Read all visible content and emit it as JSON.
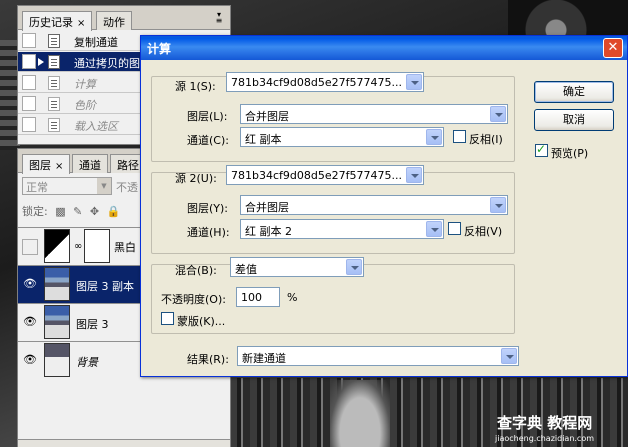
{
  "history": {
    "tabs": [
      "历史记录",
      "动作"
    ],
    "items": [
      {
        "label": "复制通道",
        "state": "normal"
      },
      {
        "label": "通过拷贝的图层",
        "state": "selected"
      },
      {
        "label": "计算",
        "state": "dim"
      },
      {
        "label": "色阶",
        "state": "dim"
      },
      {
        "label": "载入选区",
        "state": "dim"
      }
    ]
  },
  "layers": {
    "tabs": [
      "图层",
      "通道",
      "路径"
    ],
    "blend_mode": "正常",
    "opacity_label": "不透",
    "lock_label": "锁定:",
    "items": [
      {
        "name": "黑白",
        "visible": false
      },
      {
        "name": "图层 3 副本",
        "visible": true,
        "selected": true
      },
      {
        "name": "图层 3",
        "visible": true
      },
      {
        "name": "背景",
        "visible": true
      }
    ]
  },
  "dialog": {
    "title": "计算",
    "source1": {
      "label": "源 1(S):",
      "file": "781b34cf9d08d5e27f577475...",
      "layer_label": "图层(L):",
      "layer_value": "合并图层",
      "channel_label": "通道(C):",
      "channel_value": "红 副本",
      "invert_label": "反相(I)"
    },
    "source2": {
      "label": "源 2(U):",
      "file": "781b34cf9d08d5e27f577475...",
      "layer_label": "图层(Y):",
      "layer_value": "合并图层",
      "channel_label": "通道(H):",
      "channel_value": "红 副本 2",
      "invert_label": "反相(V)"
    },
    "blending": {
      "label": "混合(B):",
      "value": "差值",
      "opacity_label": "不透明度(O):",
      "opacity_value": "100",
      "opacity_unit": "%",
      "mask_label": "蒙版(K)..."
    },
    "result": {
      "label": "结果(R):",
      "value": "新建通道"
    },
    "buttons": {
      "ok": "确定",
      "cancel": "取消",
      "preview": "预览(P)"
    }
  },
  "watermark": {
    "text": "查字典 教程网",
    "url": "jiaocheng.chazidian.com"
  }
}
